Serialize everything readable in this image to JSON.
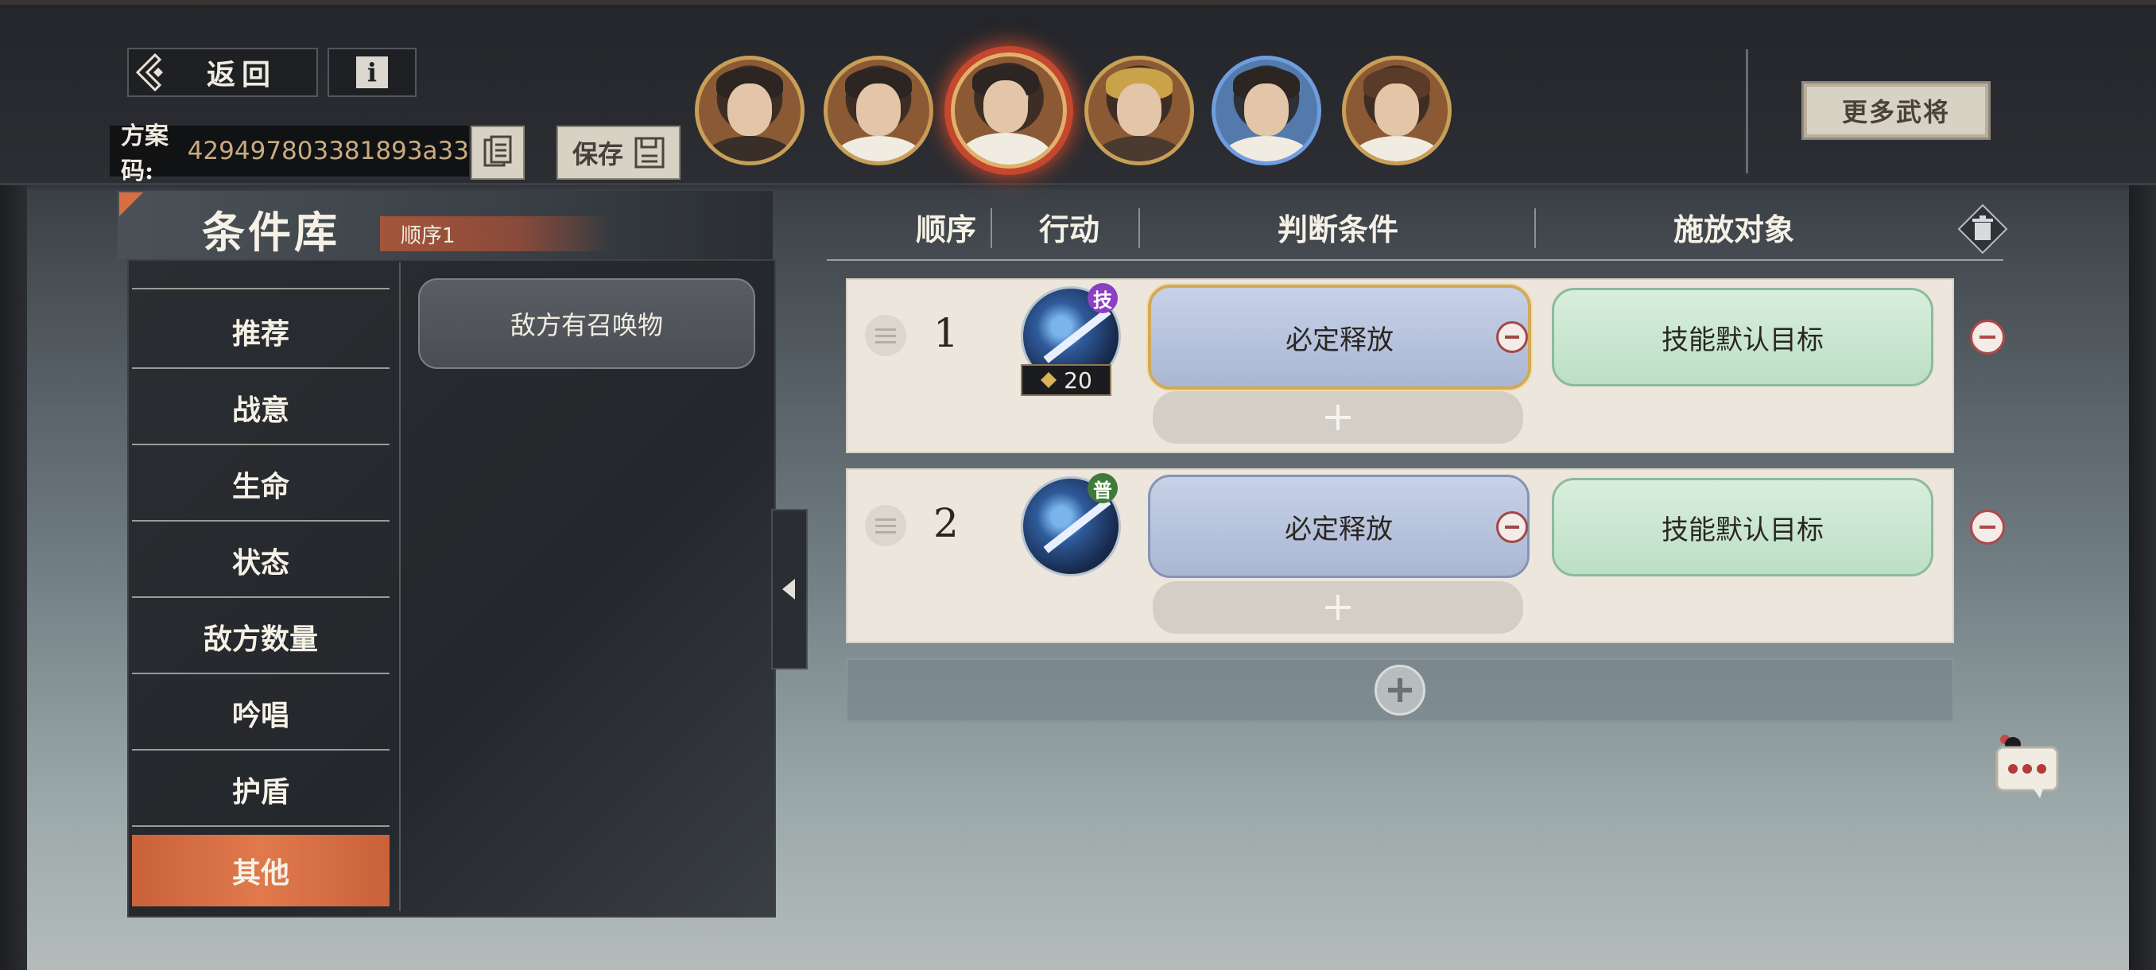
{
  "header": {
    "back_label": "返回",
    "info_label": "i",
    "plan_label": "方案码:",
    "plan_code": "429497803381893a33",
    "save_label": "保存",
    "more_generals_label": "更多武将"
  },
  "avatars": [
    {
      "name": "general-1",
      "selected": false,
      "frame": "gold"
    },
    {
      "name": "general-2",
      "selected": false,
      "frame": "gold"
    },
    {
      "name": "general-3",
      "selected": true,
      "frame": "gold"
    },
    {
      "name": "general-4",
      "selected": false,
      "frame": "gold"
    },
    {
      "name": "general-5",
      "selected": false,
      "frame": "blue"
    },
    {
      "name": "general-6",
      "selected": false,
      "frame": "gold"
    }
  ],
  "library": {
    "title": "条件库",
    "order_tab": "顺序1",
    "categories": [
      "推荐",
      "战意",
      "生命",
      "状态",
      "敌方数量",
      "吟唱",
      "护盾",
      "其他"
    ],
    "active_category": "其他",
    "conditions": [
      "敌方有召唤物"
    ]
  },
  "table": {
    "headers": {
      "order": "顺序",
      "action": "行动",
      "condition": "判断条件",
      "target": "施放对象"
    },
    "rows": [
      {
        "order": "1",
        "skill_tag": "技",
        "skill_tag_color": "#8a3fc4",
        "cost": "20",
        "condition": "必定释放",
        "target": "技能默认目标",
        "selected": true
      },
      {
        "order": "2",
        "skill_tag": "普",
        "skill_tag_color": "#3f7a3a",
        "condition": "必定释放",
        "target": "技能默认目标",
        "selected": false
      }
    ]
  },
  "colors": {
    "accent_orange": "#e07a4c",
    "condition_blue": "#aab7d4",
    "target_green": "#bcdfc5",
    "remove_red": "#b04848"
  },
  "icons": {
    "back": "back-arrow-icon",
    "info": "info-icon",
    "copy": "copy-document-icon",
    "save": "floppy-disk-icon",
    "trash": "trash-icon",
    "drag": "drag-handle-icon",
    "add": "plus-icon",
    "chat": "chat-bubble-icon",
    "collapse": "caret-left-icon"
  }
}
